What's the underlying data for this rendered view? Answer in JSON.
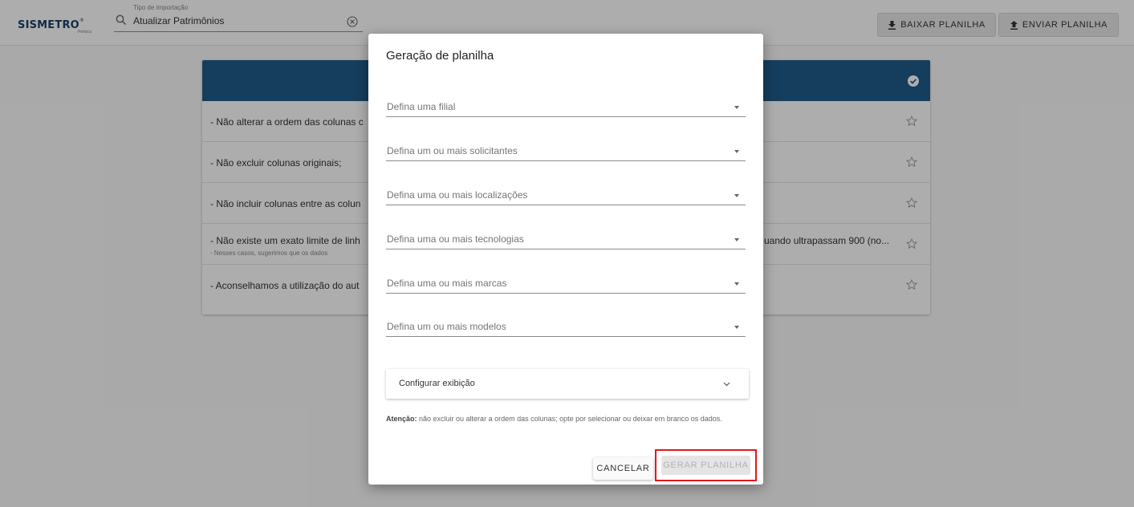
{
  "brand": {
    "name": "SISMETRO",
    "registered": "®",
    "tagline": "Portocs"
  },
  "search": {
    "label": "Tipo de importação",
    "value": "Atualizar Patrimônios"
  },
  "toolbar": {
    "download_label": "BAIXAR PLANILHA",
    "upload_label": "ENVIAR PLANILHA"
  },
  "card": {
    "rows": [
      {
        "text": "- Não alterar a ordem das colunas c"
      },
      {
        "text": "- Não excluir colunas originais;"
      },
      {
        "text": "- Não incluir colunas entre as colun"
      },
      {
        "text": "- Não existe um exato limite de linh",
        "sub": "- Nesses casos, sugerimos que os dados",
        "right": "uando ultrapassam 900 (no..."
      },
      {
        "text": "- Aconselhamos a utilização do aut"
      }
    ]
  },
  "dialog": {
    "title": "Geração de planilha",
    "fields": [
      "Defina uma filial",
      "Defina um ou mais solicitantes",
      "Defina uma ou mais localizações",
      "Defina uma ou mais tecnologias",
      "Defina uma ou mais marcas",
      "Defina um ou mais modelos"
    ],
    "panel_label": "Configurar exibição",
    "notice_bold": "Atenção:",
    "notice_text": " não excluir ou alterar a ordem das colunas; opte por selecionar ou deixar em branco os dados.",
    "cancel_label": "CANCELAR",
    "generate_label": "GERAR PLANILHA"
  },
  "colors": {
    "brand": "#1c3f6e",
    "card_header": "#1f5b8a",
    "highlight": "#e0181f"
  }
}
